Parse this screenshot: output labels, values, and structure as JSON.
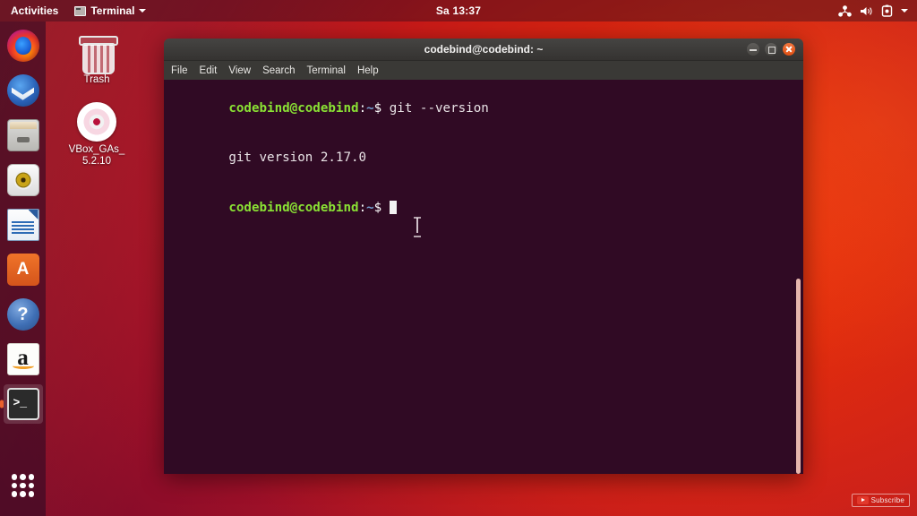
{
  "topbar": {
    "activities_label": "Activities",
    "app_menu_label": "Terminal",
    "app_menu_icon": "terminal-app-icon",
    "clock": "Sa 13:37",
    "indicators": [
      {
        "name": "network-icon"
      },
      {
        "name": "volume-icon"
      },
      {
        "name": "power-icon"
      },
      {
        "name": "chevron-down-icon"
      }
    ]
  },
  "dock": {
    "items": [
      {
        "name": "firefox",
        "label": "Firefox Web Browser",
        "running": false
      },
      {
        "name": "thunderbird",
        "label": "Thunderbird Mail",
        "running": false
      },
      {
        "name": "files",
        "label": "Files",
        "running": false
      },
      {
        "name": "rhythmbox",
        "label": "Rhythmbox",
        "running": false
      },
      {
        "name": "writer",
        "label": "LibreOffice Writer",
        "running": false
      },
      {
        "name": "software",
        "label": "Ubuntu Software",
        "running": false
      },
      {
        "name": "help",
        "label": "Help",
        "running": false
      },
      {
        "name": "amazon",
        "label": "Amazon",
        "running": false
      },
      {
        "name": "terminal",
        "label": "Terminal",
        "running": true
      }
    ],
    "show_apps_label": "Show Applications"
  },
  "desktop_icons": [
    {
      "name": "trash",
      "label": "Trash"
    },
    {
      "name": "vbox-guest-additions",
      "label": "VBox_GAs_\n5.2.10",
      "line1": "VBox_GAs_",
      "line2": "5.2.10"
    }
  ],
  "terminal": {
    "title": "codebind@codebind: ~",
    "menu": [
      "File",
      "Edit",
      "View",
      "Search",
      "Terminal",
      "Help"
    ],
    "window_buttons": {
      "minimize": "minimize-button",
      "maximize": "maximize-button",
      "close": "close-button"
    },
    "lines": [
      {
        "type": "prompt",
        "user": "codebind@codebind",
        "colon": ":",
        "path": "~",
        "dollar": "$ ",
        "command": "git --version"
      },
      {
        "type": "output",
        "text": "git version 2.17.0"
      },
      {
        "type": "prompt",
        "user": "codebind@codebind",
        "colon": ":",
        "path": "~",
        "dollar": "$ ",
        "command": ""
      }
    ]
  },
  "watermark": {
    "label": "Subscribe",
    "icon": "youtube-play-icon"
  },
  "colors": {
    "terminal_bg": "#300a24",
    "prompt_green": "#8ae234",
    "prompt_blue": "#729fcf",
    "close_button": "#e04f12",
    "desktop_red": "#d8240e",
    "dock_bg": "#300a24"
  }
}
